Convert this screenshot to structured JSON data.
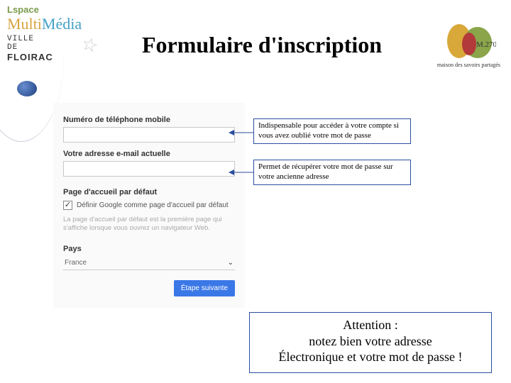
{
  "header": {
    "lspace": "Lspace",
    "multimedia": "MultiMédia",
    "ville": "VILLE",
    "de": "DE",
    "floirac": "FLOIRAC",
    "badge_label": "M.270",
    "badge_tagline": "maison des savoirs partagés"
  },
  "title": "Formulaire d'inscription",
  "form": {
    "label_phone": "Numéro de téléphone mobile",
    "label_email": "Votre adresse e-mail actuelle",
    "section_homepage": "Page d'accueil par défaut",
    "checkbox_label": "Définir Google comme page d'accueil par défaut",
    "homepage_hint": "La page d'accueil par défaut est la première page qui s'affiche lorsque vous ouvrez un navigateur Web.",
    "label_country": "Pays",
    "country_value": "France",
    "next_button": "Étape suivante"
  },
  "callouts": {
    "phone": "Indispensable pour accéder à votre compte si vous avez oublié votre mot de passe",
    "email": "Permet de récupérer votre mot de passe sur votre ancienne adresse"
  },
  "attention": {
    "line1": "Attention :",
    "line2": "notez bien votre adresse",
    "line3": "Électronique et votre mot de passe !"
  }
}
